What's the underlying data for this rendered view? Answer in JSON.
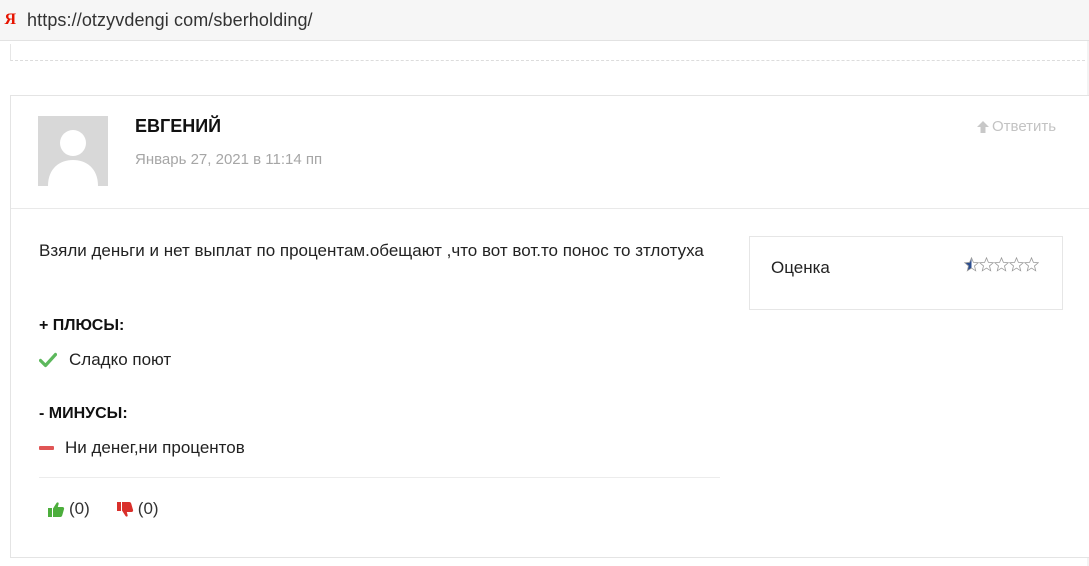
{
  "browser": {
    "url": "https://otzyvdengi com/sberholding/",
    "favicon_letter": "Я"
  },
  "review": {
    "author": "ЕВГЕНИЙ",
    "date": "Январь 27, 2021 в 11:14 пп",
    "reply_label": "Ответить",
    "text": "Взяли деньги и нет выплат по процентам.обещают ,что вот вот.то понос то зтлотуха",
    "pros_heading": "+ ПЛЮСЫ:",
    "pros_item": "Сладко поют",
    "cons_heading": "- МИНУСЫ:",
    "cons_item": "Ни денег,ни процентов",
    "likes": "(0)",
    "dislikes": "(0)"
  },
  "rating": {
    "label": "Оценка",
    "value": 0.5,
    "max": 5
  },
  "colors": {
    "accent_star": "#2b4d8f",
    "check": "#5cb85c",
    "minus": "#e05555",
    "thumb_up": "#4cae3c",
    "thumb_down": "#d9302b",
    "reply": "#c3c3c3"
  }
}
